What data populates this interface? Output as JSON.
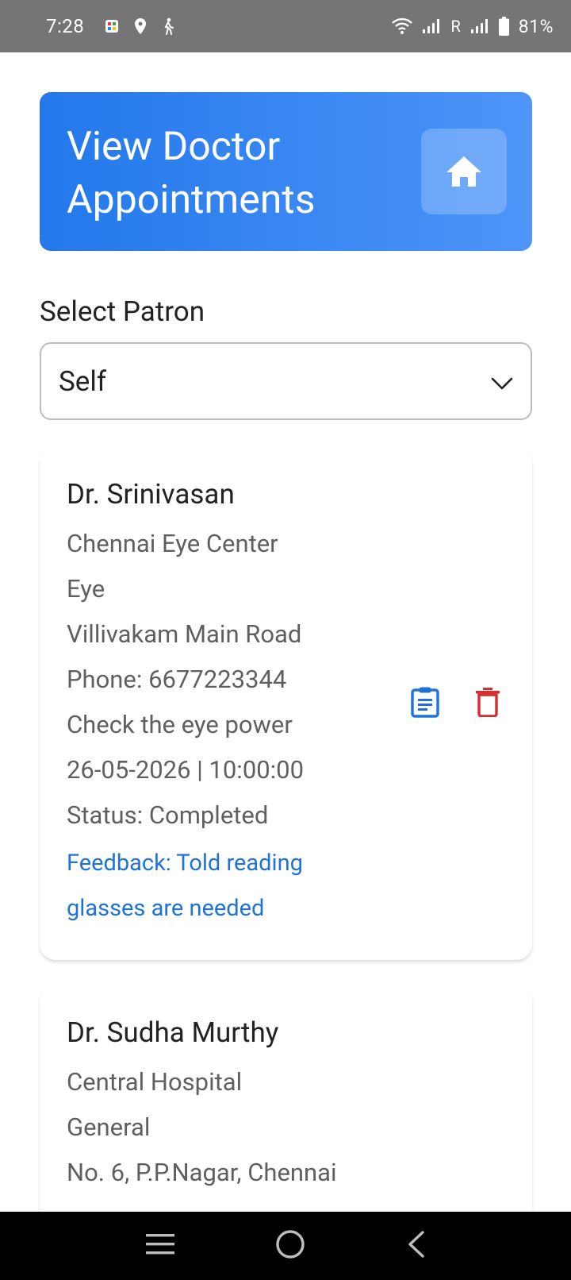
{
  "status_bar": {
    "time": "7:28",
    "network_label": "R",
    "battery": "81%"
  },
  "header": {
    "title": "View Doctor Appointments",
    "home_icon": "home-icon"
  },
  "patron": {
    "label": "Select Patron",
    "selected": "Self"
  },
  "appointments": [
    {
      "doctor": "Dr. Srinivasan",
      "hospital": "Chennai Eye Center",
      "specialty": "Eye",
      "address": "Villivakam Main Road",
      "phone": "Phone: 6677223344",
      "reason": "Check the eye power",
      "datetime": "26-05-2026 | 10:00:00",
      "status": "Status: Completed",
      "feedback": "Feedback: Told reading glasses are needed"
    },
    {
      "doctor": "Dr. Sudha Murthy",
      "hospital": "Central Hospital",
      "specialty": "General",
      "address": "No. 6, P.P.Nagar, Chennai"
    }
  ],
  "colors": {
    "header_start": "#2378ea",
    "header_end": "#4d95f8",
    "edit_icon": "#1f73d8",
    "delete_icon": "#d32f2f",
    "feedback_text": "#1f73d8"
  }
}
